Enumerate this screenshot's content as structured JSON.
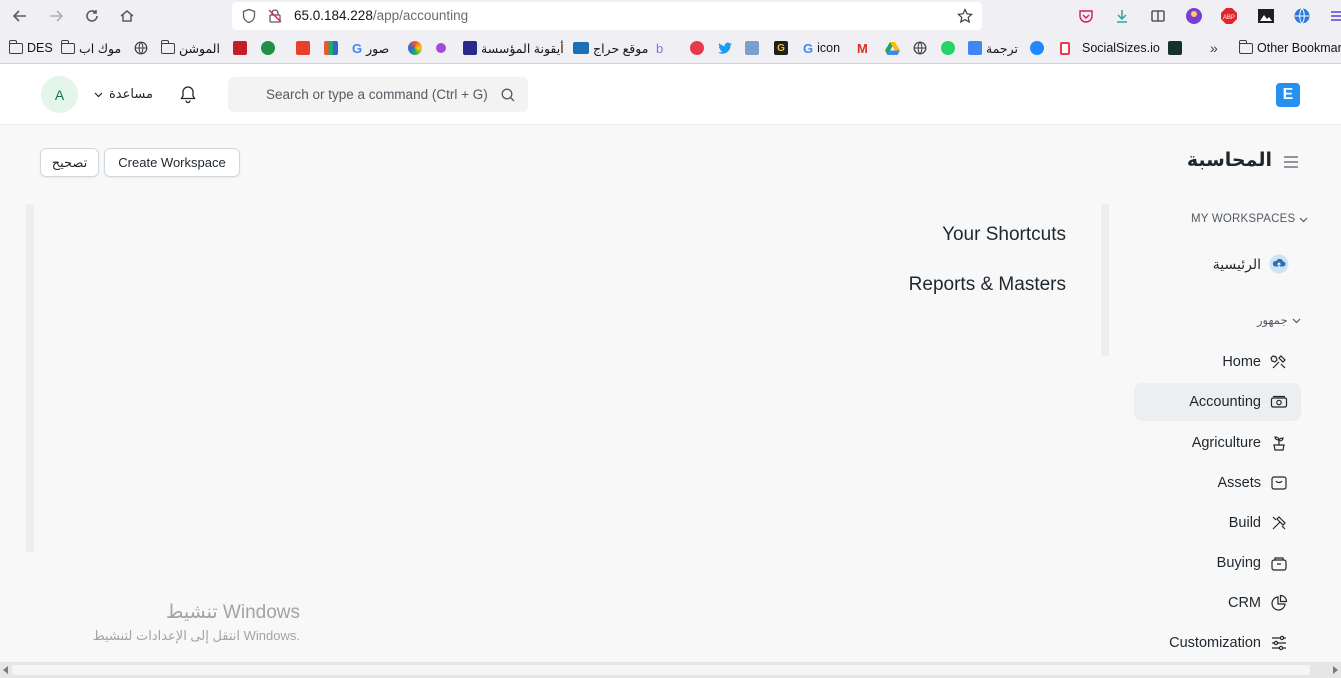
{
  "browser": {
    "url_host": "65.0.184.228",
    "url_path": "/app/accounting",
    "bookmarks": [
      {
        "label": "DES",
        "kind": "folder"
      },
      {
        "label": "موك اب",
        "kind": "folder"
      },
      {
        "label": "الموشن",
        "kind": "folder"
      },
      {
        "label": "صور",
        "kind": "google"
      },
      {
        "label": "أيقونة المؤسسة",
        "kind": "site"
      },
      {
        "label": "موقع حراج",
        "kind": "site"
      },
      {
        "label": "icon",
        "kind": "google"
      },
      {
        "label": "ترجمة",
        "kind": "site"
      },
      {
        "label": "SocialSizes.io",
        "kind": "site"
      },
      {
        "label": "Other Bookmarks",
        "kind": "folder"
      }
    ]
  },
  "navbar": {
    "avatar_initial": "A",
    "help_label": "مساعدة",
    "search_placeholder": "Search or type a command (Ctrl + G)",
    "logo_letter": "E"
  },
  "page": {
    "title": "المحاسبة",
    "create_workspace_label": "Create Workspace",
    "edit_label": "تصحيح"
  },
  "content": {
    "shortcuts_heading": "Your Shortcuts",
    "reports_heading": "Reports & Masters"
  },
  "sidebar": {
    "my_workspaces_label": "MY WORKSPACES",
    "home_item": "الرئيسية",
    "public_label": "جمهور",
    "items": [
      {
        "label": "Home",
        "icon": "tools-icon"
      },
      {
        "label": "Accounting",
        "icon": "money-icon",
        "active": true
      },
      {
        "label": "Agriculture",
        "icon": "plant-icon"
      },
      {
        "label": "Assets",
        "icon": "box-icon"
      },
      {
        "label": "Build",
        "icon": "hammer-icon"
      },
      {
        "label": "Buying",
        "icon": "bag-icon"
      },
      {
        "label": "CRM",
        "icon": "pie-icon"
      },
      {
        "label": "Customization",
        "icon": "sliders-icon"
      }
    ]
  },
  "watermark": {
    "title": "تنشيط Windows",
    "subtitle": "انتقل إلى الإعدادات لتنشيط Windows."
  },
  "colors": {
    "accent": "#2490ef",
    "avatar_bg": "#e4f5e9",
    "avatar_fg": "#16794c",
    "active_item_bg": "#eceef0"
  }
}
